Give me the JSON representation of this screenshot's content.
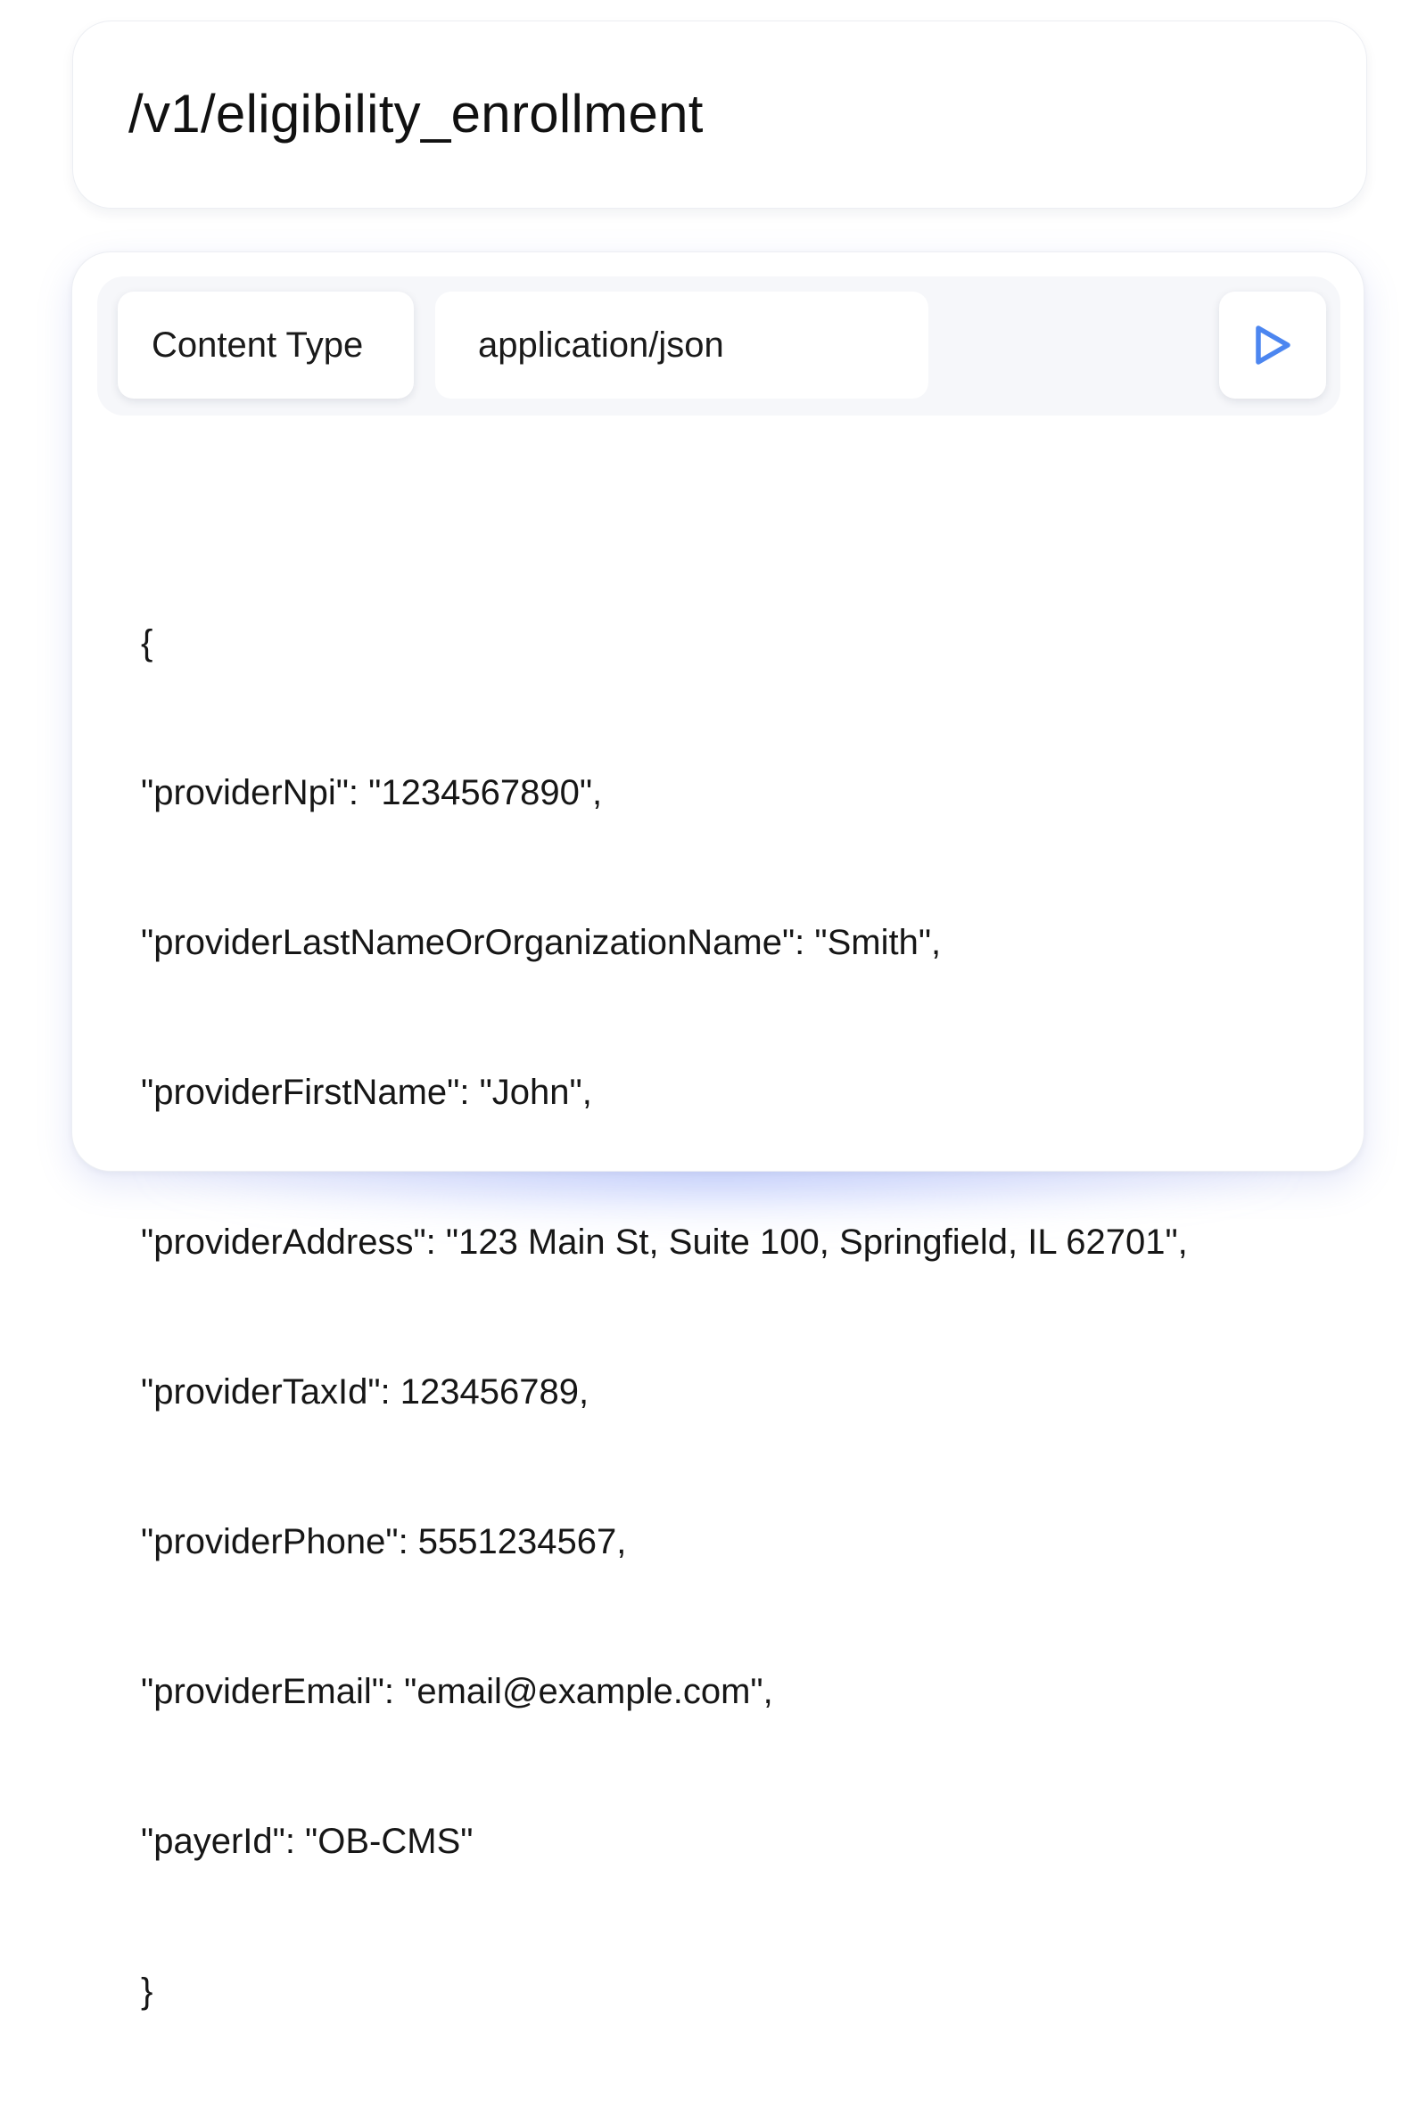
{
  "endpoint": {
    "path": "/v1/eligibility_enrollment"
  },
  "request": {
    "content_type_label": "Content Type",
    "content_type_value": "application/json",
    "run_icon": "play-icon",
    "accent_color": "#4c86f0",
    "body_lines": [
      "{",
      "\"providerNpi\": \"1234567890\",",
      "\"providerLastNameOrOrganizationName\": \"Smith\",",
      "\"providerFirstName\": \"John\",",
      "\"providerAddress\": \"123 Main St, Suite 100, Springfield, IL 62701\",",
      "\"providerTaxId\": 123456789,",
      "\"providerPhone\": 5551234567,",
      "\"providerEmail\": \"email@example.com\",",
      "\"payerId\": \"OB-CMS\"",
      "}"
    ]
  }
}
